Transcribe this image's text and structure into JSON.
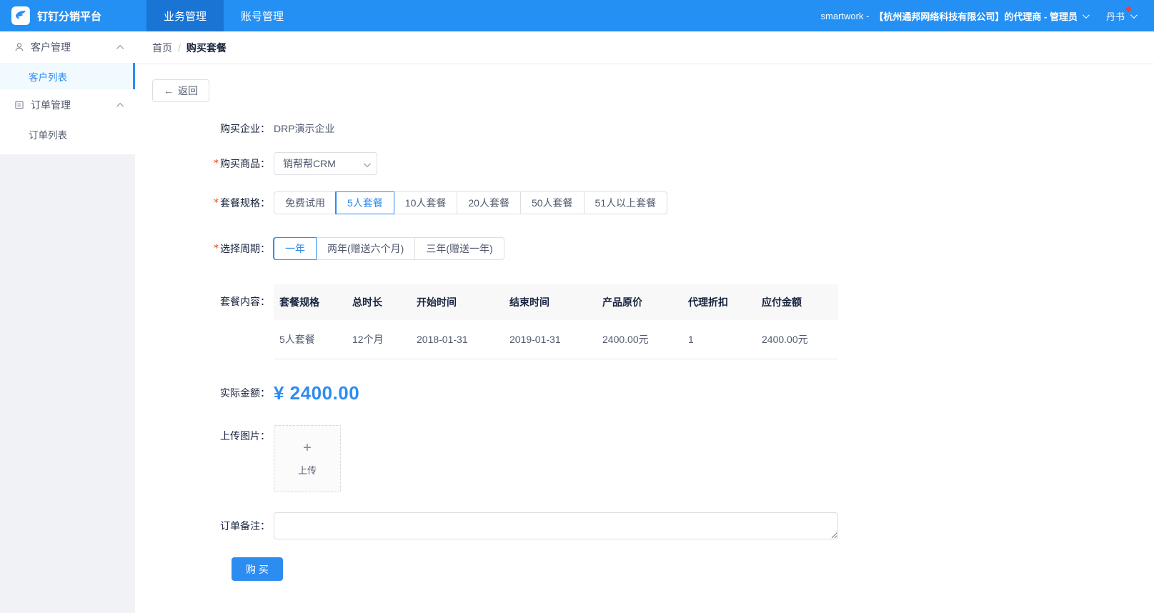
{
  "colors": {
    "primary": "#2d8cf0",
    "topbar": "#2490f3",
    "topbar-active": "#1a74d4",
    "badge": "#f03e3e",
    "border": "#dcdee2",
    "text": "#515a6e",
    "text-dark": "#17233d",
    "table-header-bg": "#f8f8f9",
    "sidebar-active-bg": "#f0faff",
    "page-bg": "#f0f2f5"
  },
  "topbar": {
    "logo_text": "钉钉分销平台",
    "nav": [
      {
        "label": "业务管理"
      },
      {
        "label": "账号管理"
      }
    ],
    "active_nav": "业务管理",
    "user_prefix": "smartwork -",
    "agent_info": "【杭州通邦网络科技有限公司】的代理商 - 管理员",
    "user_name": "丹书"
  },
  "sidebar": {
    "groups": [
      {
        "label": "客户管理",
        "items": [
          {
            "label": "客户列表"
          }
        ]
      },
      {
        "label": "订单管理",
        "items": [
          {
            "label": "订单列表"
          }
        ]
      }
    ],
    "active_item": "客户列表"
  },
  "breadcrumb": {
    "home": "首页",
    "separator": "/",
    "current": "购买套餐"
  },
  "toolbar": {
    "back_label": "返回"
  },
  "icons": {
    "back_arrow": "←",
    "plus": "+"
  },
  "form": {
    "required_mark": "*",
    "company": {
      "label": "购买企业：",
      "value": "DRP演示企业"
    },
    "product": {
      "label": "购买商品：",
      "value": "销帮帮CRM"
    },
    "spec": {
      "label": "套餐规格：",
      "options": [
        "免费试用",
        "5人套餐",
        "10人套餐",
        "20人套餐",
        "50人套餐",
        "51人以上套餐"
      ],
      "selected": "5人套餐"
    },
    "period": {
      "label": "选择周期：",
      "options": [
        "一年",
        "两年(赠送六个月)",
        "三年(赠送一年)"
      ],
      "selected": "一年"
    },
    "package_content": {
      "label": "套餐内容："
    },
    "amount": {
      "label": "实际金额：",
      "value": "¥ 2400.00"
    },
    "upload": {
      "label": "上传图片：",
      "text": "上传"
    },
    "remark": {
      "label": "订单备注：",
      "value": ""
    },
    "buy_label": "购 买"
  },
  "table": {
    "headers": [
      "套餐规格",
      "总时长",
      "开始时间",
      "结束时间",
      "产品原价",
      "代理折扣",
      "应付金额"
    ],
    "rows": [
      [
        "5人套餐",
        "12个月",
        "2018-01-31",
        "2019-01-31",
        "2400.00元",
        "1",
        "2400.00元"
      ]
    ]
  }
}
